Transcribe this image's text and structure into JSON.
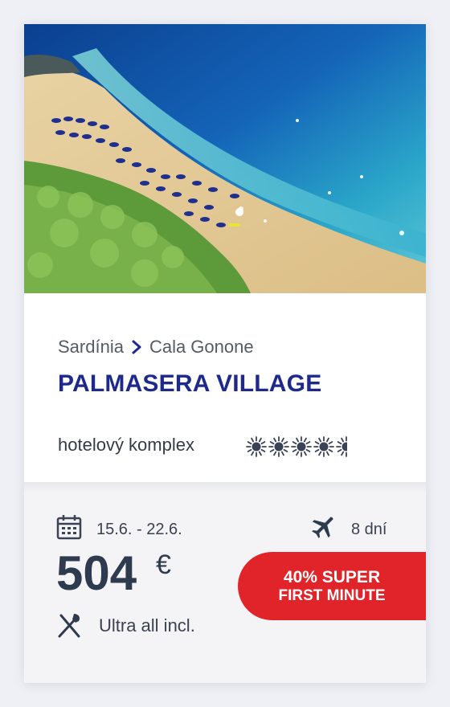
{
  "hotel": {
    "region": "Sardínia",
    "resort": "Cala Gonone",
    "name": "PALMASERA VILLAGE",
    "type": "hotelový komplex",
    "rating_icons": "sun-icon",
    "rating_count": 5
  },
  "trip": {
    "dates": "15.6. - 22.6.",
    "duration": "8 dní",
    "price": "504",
    "currency": "€",
    "board": "Ultra all incl."
  },
  "badge": {
    "line1": "40% SUPER",
    "line2": "FIRST MINUTE"
  },
  "colors": {
    "title": "#1d2a8c",
    "badge": "#e1242a",
    "price": "#2e3a4d"
  }
}
